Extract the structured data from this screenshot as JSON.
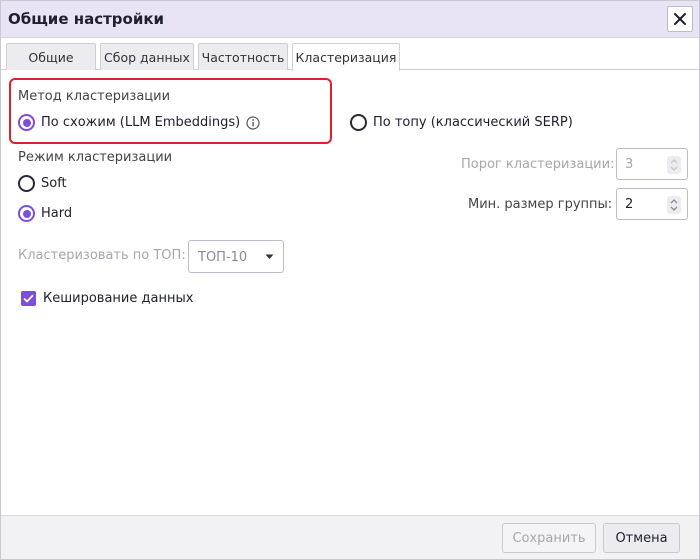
{
  "window": {
    "title": "Общие настройки",
    "close_icon": "close-icon"
  },
  "tabs": [
    {
      "label": "Общие",
      "active": false
    },
    {
      "label": "Сбор данных",
      "active": false
    },
    {
      "label": "Частотность",
      "active": false
    },
    {
      "label": "Кластеризация",
      "active": true
    }
  ],
  "method": {
    "label": "Метод кластеризации",
    "options": [
      {
        "label": "По схожим (LLM Embeddings)",
        "checked": true,
        "icon": "info-icon"
      },
      {
        "label": "По топу (классический SERP)",
        "checked": false
      }
    ],
    "highlight_color": "#e0202a"
  },
  "mode": {
    "label": "Режим кластеризации",
    "options": [
      {
        "label": "Soft",
        "checked": false
      },
      {
        "label": "Hard",
        "checked": true
      }
    ]
  },
  "threshold": {
    "label": "Порог кластеризации:",
    "value": "3",
    "disabled": true
  },
  "min_group": {
    "label": "Мин. размер группы:",
    "value": "2",
    "disabled": false
  },
  "cluster_by_top": {
    "label": "Кластеризовать по ТОП:",
    "selected": "ТОП-10",
    "disabled": true
  },
  "caching": {
    "label": "Кеширование данных",
    "checked": true
  },
  "footer": {
    "save_label": "Сохранить",
    "save_disabled": true,
    "cancel_label": "Отмена"
  },
  "accent_color": "#7d4ddb"
}
